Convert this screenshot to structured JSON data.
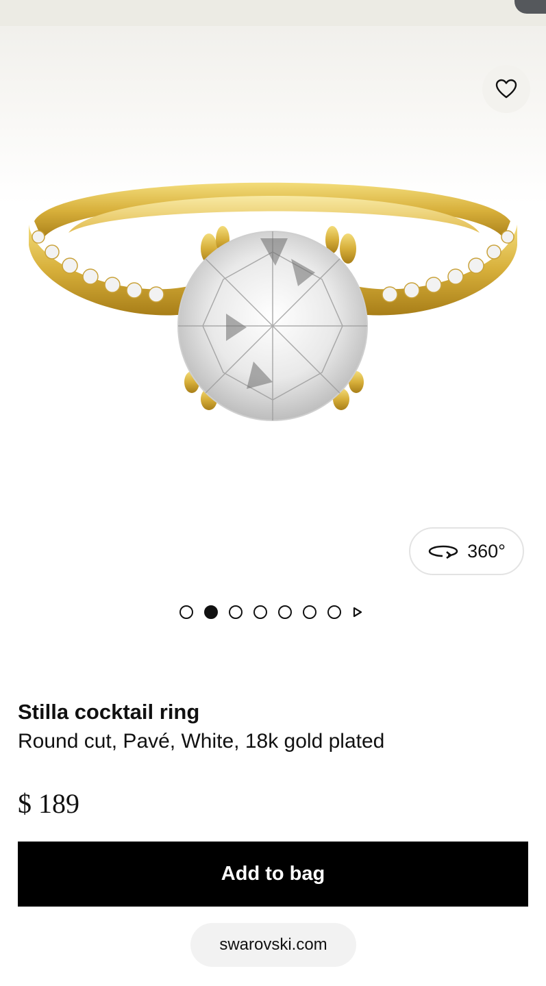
{
  "browser": {
    "url": "swarovski.com"
  },
  "gallery": {
    "wishlist_icon": "heart-icon",
    "image_alt": "Stilla cocktail ring",
    "view_360_label": "360°",
    "view_360_icon": "rotate-360-icon",
    "slide_count": 7,
    "active_slide": 2
  },
  "product": {
    "name": "Stilla cocktail ring",
    "description": "Round cut, Pavé, White, 18k gold plated",
    "price": "$ 189"
  },
  "actions": {
    "add_to_bag": "Add to bag"
  },
  "colors": {
    "gold": "#d8b43a",
    "button_bg": "#000000",
    "button_text": "#ffffff"
  }
}
